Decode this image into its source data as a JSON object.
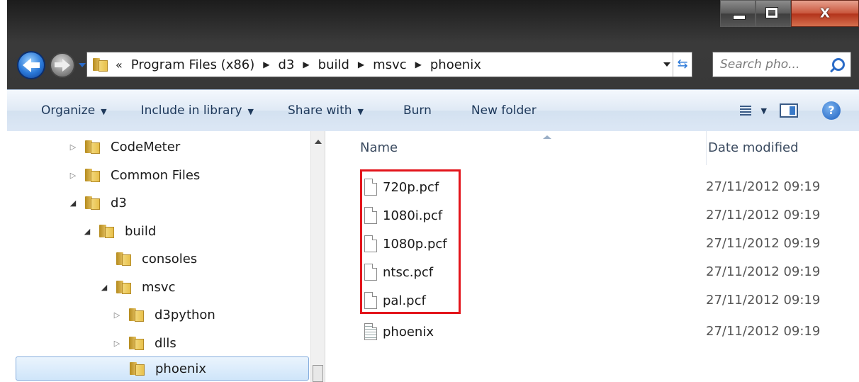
{
  "colors": {
    "highlight": "#e3141b",
    "selection": "#cfe5fa",
    "command_bar_text": "#1e395b"
  },
  "window": {
    "caption": {
      "min_icon": "minimize-icon",
      "max_icon": "maximize-icon",
      "close_label": "X"
    }
  },
  "nav": {
    "back_icon": "back-arrow-icon",
    "forward_icon": "forward-arrow-icon",
    "breadcrumb_prefix": "«",
    "crumbs": [
      "Program Files (x86)",
      "d3",
      "build",
      "msvc",
      "phoenix"
    ],
    "refresh_icon": "refresh-icon",
    "search_placeholder": "Search pho..."
  },
  "command_bar": {
    "organize": "Organize",
    "include": "Include in library",
    "share": "Share with",
    "burn": "Burn",
    "new_folder": "New folder",
    "caret": "▼"
  },
  "tree": [
    {
      "label": "CodeMeter",
      "expander": "▷"
    },
    {
      "label": "Common Files",
      "expander": "▷"
    },
    {
      "label": "d3",
      "expander": "◢"
    },
    {
      "label": "build",
      "expander": "◢"
    },
    {
      "label": "consoles",
      "expander": ""
    },
    {
      "label": "msvc",
      "expander": "◢"
    },
    {
      "label": "d3python",
      "expander": "▷"
    },
    {
      "label": "dlls",
      "expander": "▷"
    },
    {
      "label": "phoenix",
      "expander": ""
    }
  ],
  "columns": {
    "name": "Name",
    "date": "Date modified"
  },
  "files": [
    {
      "name": "720p.pcf",
      "date": "27/11/2012 09:19"
    },
    {
      "name": "1080i.pcf",
      "date": "27/11/2012 09:19"
    },
    {
      "name": "1080p.pcf",
      "date": "27/11/2012 09:19"
    },
    {
      "name": "ntsc.pcf",
      "date": "27/11/2012 09:19"
    },
    {
      "name": "pal.pcf",
      "date": "27/11/2012 09:19"
    },
    {
      "name": "phoenix",
      "date": "27/11/2012 09:19"
    }
  ]
}
